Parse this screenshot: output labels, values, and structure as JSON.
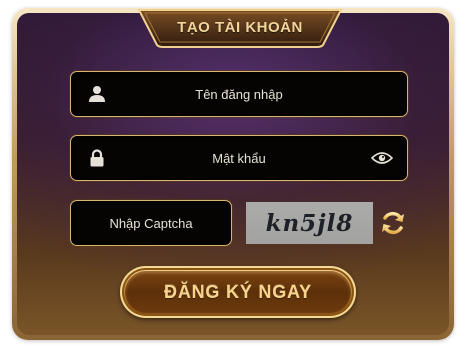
{
  "dialog": {
    "title": "TẠO TÀI KHOẢN"
  },
  "form": {
    "username": {
      "placeholder": "Tên đăng nhập",
      "icon": "user-icon"
    },
    "password": {
      "placeholder": "Mật khẩu",
      "icon": "lock-icon",
      "toggle_icon": "eye-icon"
    },
    "captcha": {
      "placeholder": "Nhập Captcha",
      "code": "kn5jl8",
      "refresh_icon": "refresh-icon"
    },
    "submit_label": "ĐĂNG KÝ NGAY"
  },
  "colors": {
    "gold_border": "#d9b372",
    "gold_text": "#f1d59c",
    "field_bg": "#050403",
    "captcha_bg": "#a7a7a5"
  }
}
